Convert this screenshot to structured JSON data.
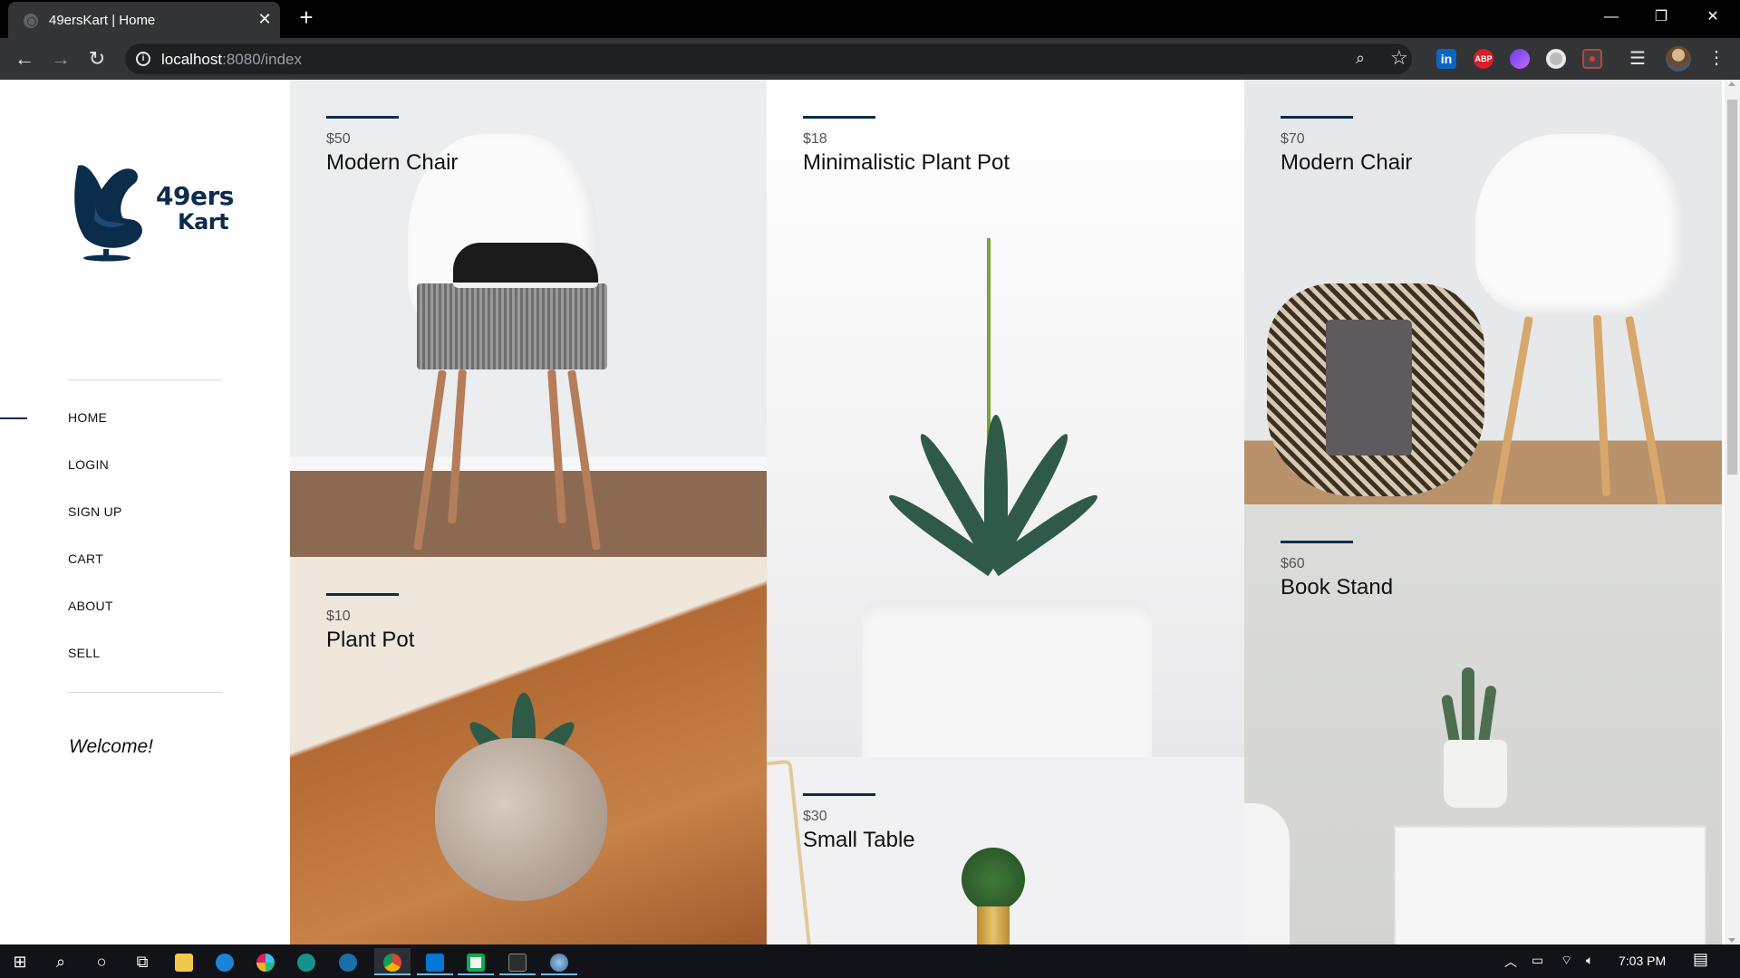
{
  "browser": {
    "tab_title": "49ersKart | Home",
    "url_host": "localhost",
    "url_path": ":8080/index",
    "window_controls": {
      "minimize": "—",
      "maximize": "❐",
      "close": "✕"
    },
    "extensions": [
      "linkedin-icon",
      "adblock-icon",
      "pen-icon",
      "circle-icon",
      "screen-record-icon"
    ],
    "linkedin_label": "in",
    "abp_label": "ABP"
  },
  "site": {
    "logo": {
      "line1": "49ers",
      "line2": "Kart"
    },
    "nav": [
      {
        "label": "HOME",
        "active": true
      },
      {
        "label": "LOGIN",
        "active": false
      },
      {
        "label": "SIGN UP",
        "active": false
      },
      {
        "label": "CART",
        "active": false
      },
      {
        "label": "ABOUT",
        "active": false
      },
      {
        "label": "SELL",
        "active": false
      }
    ],
    "welcome": "Welcome!",
    "accent_color": "#0c2c4c"
  },
  "products": [
    {
      "price": "$50",
      "name": "Modern Chair"
    },
    {
      "price": "$18",
      "name": "Minimalistic Plant Pot"
    },
    {
      "price": "$70",
      "name": "Modern Chair"
    },
    {
      "price": "$10",
      "name": "Plant Pot"
    },
    {
      "price": "$30",
      "name": "Small Table"
    },
    {
      "price": "$60",
      "name": "Book Stand"
    }
  ],
  "taskbar": {
    "apps": [
      "windows-start-icon",
      "search-icon",
      "cortana-icon",
      "task-view-icon",
      "file-explorer-icon",
      "edge-icon",
      "slack-icon",
      "gitkraken-icon",
      "steam-icon",
      "chrome-icon",
      "vscode-icon",
      "mongodb-compass-icon",
      "terminal-icon",
      "other-app-icon"
    ],
    "clock": "7:03 PM"
  }
}
